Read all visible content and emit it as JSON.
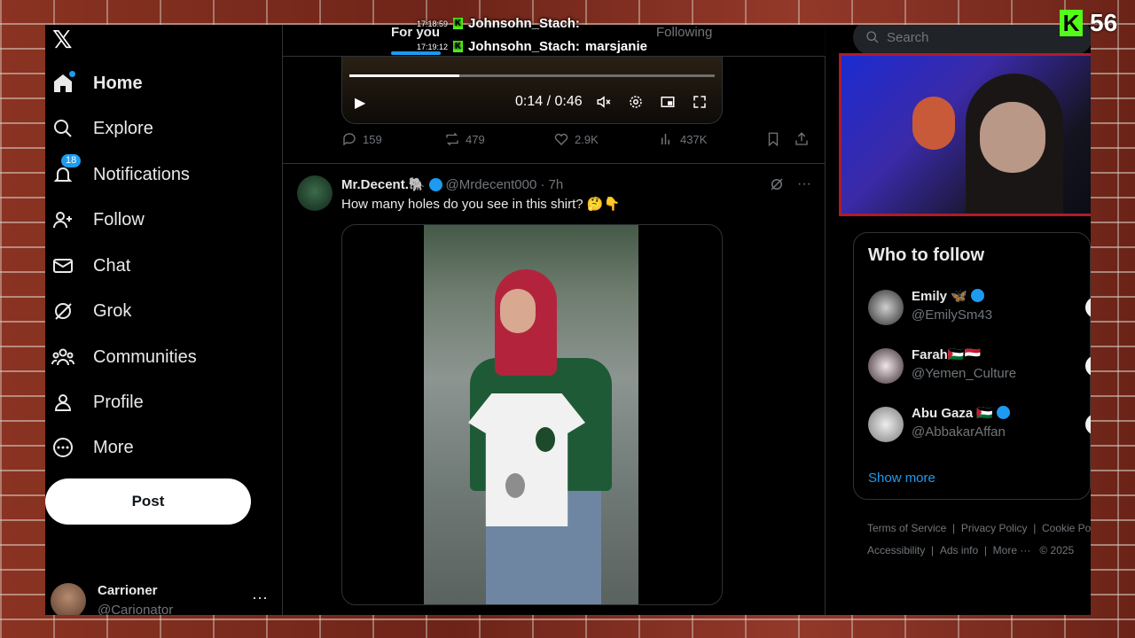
{
  "nav": {
    "logo": "𝕏",
    "items": [
      {
        "label": "Home",
        "icon": "home-icon"
      },
      {
        "label": "Explore",
        "icon": "search-icon"
      },
      {
        "label": "Notifications",
        "icon": "bell-icon",
        "badge": "18"
      },
      {
        "label": "Follow",
        "icon": "follow-icon"
      },
      {
        "label": "Chat",
        "icon": "mail-icon"
      },
      {
        "label": "Grok",
        "icon": "grok-icon"
      },
      {
        "label": "Communities",
        "icon": "communities-icon"
      },
      {
        "label": "Profile",
        "icon": "profile-icon"
      },
      {
        "label": "More",
        "icon": "more-circle-icon"
      }
    ],
    "post_label": "Post",
    "account": {
      "name": "Carrioner",
      "handle": "@Carionator",
      "more": "···"
    }
  },
  "tabs": {
    "for_you": "For you",
    "following": "Following"
  },
  "prev_tweet": {
    "video": {
      "time": "0:14 / 0:46",
      "progress": 0.3
    },
    "actions": {
      "replies": "159",
      "reposts": "479",
      "likes": "2.9K",
      "views": "437K"
    }
  },
  "tweet": {
    "name": "Mr.Decent.🐘",
    "handle": "@Mrdecent000",
    "time": "· 7h",
    "text": "How many holes do you see in this shirt? 🤔👇",
    "more": "···"
  },
  "search": {
    "placeholder": "Search"
  },
  "who_to_follow": {
    "title": "Who to follow",
    "users": [
      {
        "name": "Emily 🦋",
        "handle": "@EmilySm43",
        "verified": true
      },
      {
        "name": "Farah🇵🇸🇾🇪",
        "handle": "@Yemen_Culture",
        "verified": false
      },
      {
        "name": "Abu Gaza 🇵🇸",
        "handle": "@AbbakarAffan",
        "verified": true
      }
    ],
    "show_more": "Show more"
  },
  "footer": {
    "line1": [
      "Terms of Service",
      "|",
      "Privacy Policy",
      "|",
      "Cookie Po"
    ],
    "line2": [
      "Accessibility",
      "|",
      "Ads info",
      "|",
      "More ···",
      "© 2025"
    ]
  },
  "stream_overlay": {
    "chat": [
      {
        "time": "17:18:59",
        "user": "Johnsohn_Stach:",
        "msg": ""
      },
      {
        "time": "17:19:12",
        "user": "Johnsohn_Stach:",
        "msg": "marsjanie"
      }
    ],
    "viewer_count": "56",
    "kick_letter": "K"
  },
  "colors": {
    "accent": "#1d9bf0",
    "kick": "#53fc18",
    "webcam_border": "#b11b2a"
  }
}
